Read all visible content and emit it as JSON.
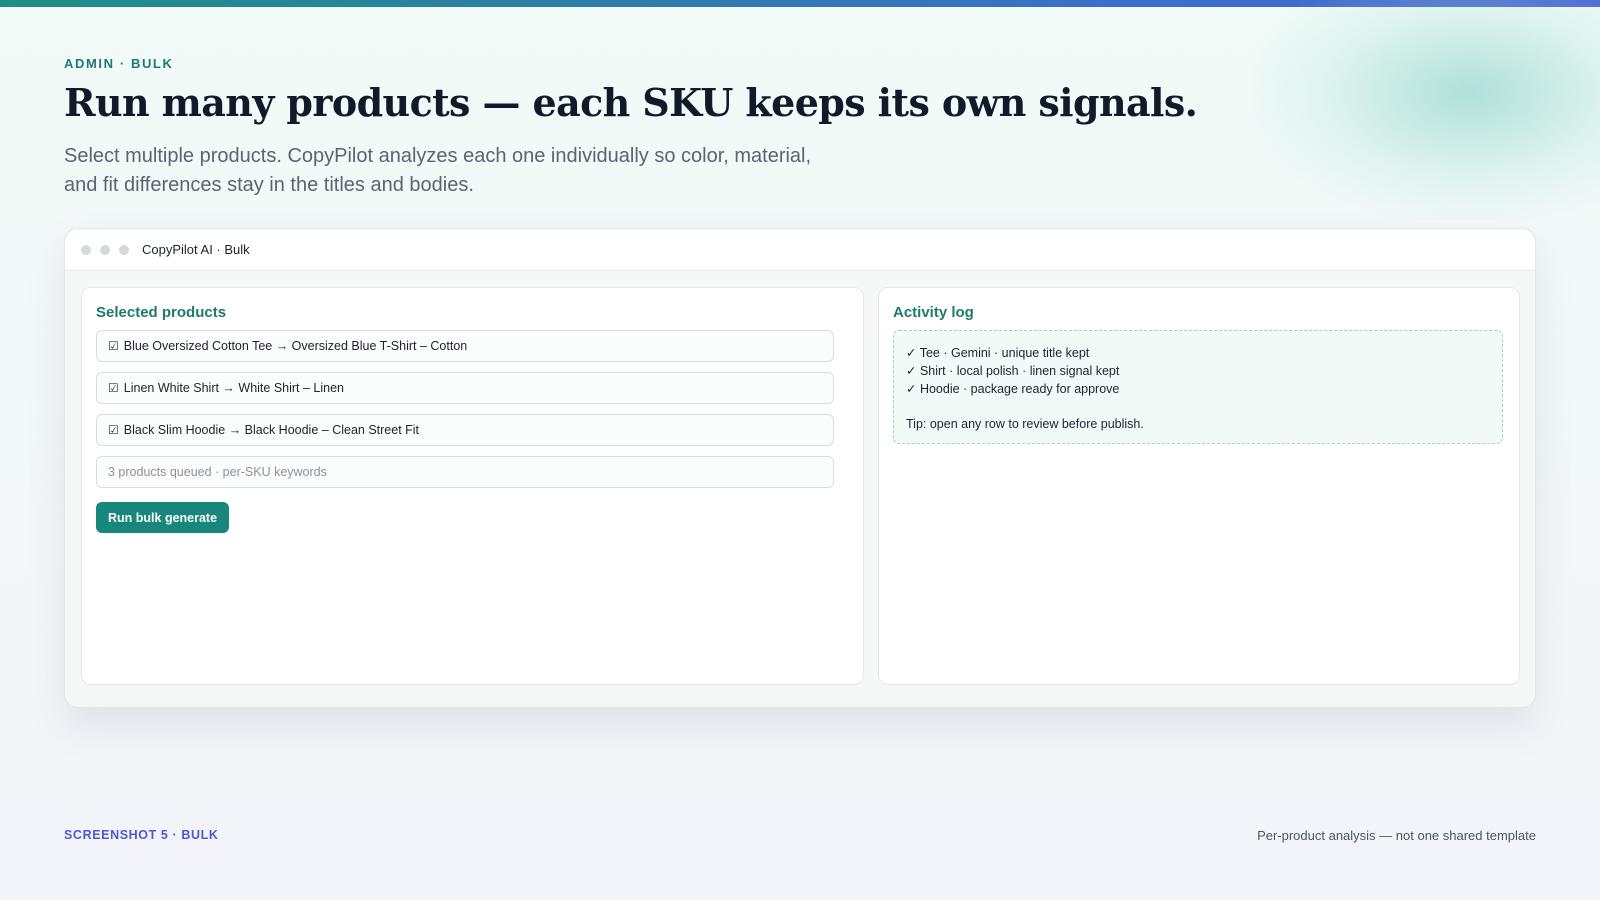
{
  "hero": {
    "eyebrow": "ADMIN · BULK",
    "title": "Run many products — each SKU keeps its own signals.",
    "subtitle": "Select multiple products. CopyPilot analyzes each one individually so color, material, and fit differences stay in the titles and bodies."
  },
  "window": {
    "title": "CopyPilot AI · Bulk"
  },
  "selected_products": {
    "heading": "Selected products",
    "check_glyph": "☑",
    "items": [
      {
        "label": "Blue Oversized Cotton Tee → Oversized Blue T-Shirt – Cotton"
      },
      {
        "label": "Linen White Shirt → White Shirt – Linen"
      },
      {
        "label": "Black Slim Hoodie → Black Hoodie – Clean Street Fit"
      }
    ],
    "queue_placeholder": "3 products queued · per-SKU keywords",
    "run_button_label": "Run bulk generate"
  },
  "activity_log": {
    "heading": "Activity log",
    "lines": [
      "✓ Tee · Gemini · unique title kept",
      "✓ Shirt · local polish · linen signal kept",
      "✓ Hoodie · package ready for approve"
    ],
    "tip": "Tip: open any row to review before publish."
  },
  "footer": {
    "left": "SCREENSHOT 5 · BULK",
    "right": "Per-product analysis — not one shared template"
  },
  "colors": {
    "accent": "#1d7b6c",
    "button": "#16877a",
    "footer_label": "#4c5ad0"
  }
}
